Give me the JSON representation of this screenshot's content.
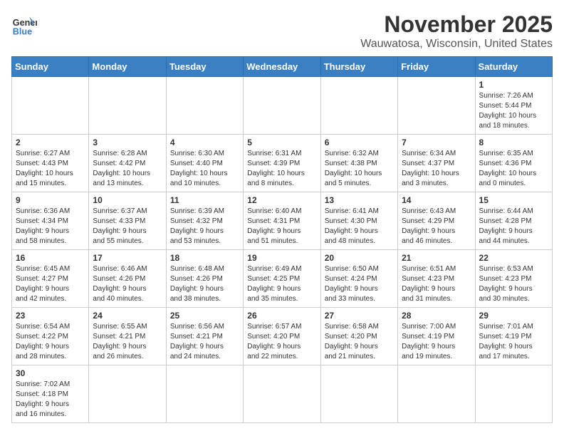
{
  "header": {
    "logo_general": "General",
    "logo_blue": "Blue",
    "month": "November 2025",
    "location": "Wauwatosa, Wisconsin, United States"
  },
  "weekdays": [
    "Sunday",
    "Monday",
    "Tuesday",
    "Wednesday",
    "Thursday",
    "Friday",
    "Saturday"
  ],
  "weeks": [
    [
      {
        "day": "",
        "info": ""
      },
      {
        "day": "",
        "info": ""
      },
      {
        "day": "",
        "info": ""
      },
      {
        "day": "",
        "info": ""
      },
      {
        "day": "",
        "info": ""
      },
      {
        "day": "",
        "info": ""
      },
      {
        "day": "1",
        "info": "Sunrise: 7:26 AM\nSunset: 5:44 PM\nDaylight: 10 hours\nand 18 minutes."
      }
    ],
    [
      {
        "day": "2",
        "info": "Sunrise: 6:27 AM\nSunset: 4:43 PM\nDaylight: 10 hours\nand 15 minutes."
      },
      {
        "day": "3",
        "info": "Sunrise: 6:28 AM\nSunset: 4:42 PM\nDaylight: 10 hours\nand 13 minutes."
      },
      {
        "day": "4",
        "info": "Sunrise: 6:30 AM\nSunset: 4:40 PM\nDaylight: 10 hours\nand 10 minutes."
      },
      {
        "day": "5",
        "info": "Sunrise: 6:31 AM\nSunset: 4:39 PM\nDaylight: 10 hours\nand 8 minutes."
      },
      {
        "day": "6",
        "info": "Sunrise: 6:32 AM\nSunset: 4:38 PM\nDaylight: 10 hours\nand 5 minutes."
      },
      {
        "day": "7",
        "info": "Sunrise: 6:34 AM\nSunset: 4:37 PM\nDaylight: 10 hours\nand 3 minutes."
      },
      {
        "day": "8",
        "info": "Sunrise: 6:35 AM\nSunset: 4:36 PM\nDaylight: 10 hours\nand 0 minutes."
      }
    ],
    [
      {
        "day": "9",
        "info": "Sunrise: 6:36 AM\nSunset: 4:34 PM\nDaylight: 9 hours\nand 58 minutes."
      },
      {
        "day": "10",
        "info": "Sunrise: 6:37 AM\nSunset: 4:33 PM\nDaylight: 9 hours\nand 55 minutes."
      },
      {
        "day": "11",
        "info": "Sunrise: 6:39 AM\nSunset: 4:32 PM\nDaylight: 9 hours\nand 53 minutes."
      },
      {
        "day": "12",
        "info": "Sunrise: 6:40 AM\nSunset: 4:31 PM\nDaylight: 9 hours\nand 51 minutes."
      },
      {
        "day": "13",
        "info": "Sunrise: 6:41 AM\nSunset: 4:30 PM\nDaylight: 9 hours\nand 48 minutes."
      },
      {
        "day": "14",
        "info": "Sunrise: 6:43 AM\nSunset: 4:29 PM\nDaylight: 9 hours\nand 46 minutes."
      },
      {
        "day": "15",
        "info": "Sunrise: 6:44 AM\nSunset: 4:28 PM\nDaylight: 9 hours\nand 44 minutes."
      }
    ],
    [
      {
        "day": "16",
        "info": "Sunrise: 6:45 AM\nSunset: 4:27 PM\nDaylight: 9 hours\nand 42 minutes."
      },
      {
        "day": "17",
        "info": "Sunrise: 6:46 AM\nSunset: 4:26 PM\nDaylight: 9 hours\nand 40 minutes."
      },
      {
        "day": "18",
        "info": "Sunrise: 6:48 AM\nSunset: 4:26 PM\nDaylight: 9 hours\nand 38 minutes."
      },
      {
        "day": "19",
        "info": "Sunrise: 6:49 AM\nSunset: 4:25 PM\nDaylight: 9 hours\nand 35 minutes."
      },
      {
        "day": "20",
        "info": "Sunrise: 6:50 AM\nSunset: 4:24 PM\nDaylight: 9 hours\nand 33 minutes."
      },
      {
        "day": "21",
        "info": "Sunrise: 6:51 AM\nSunset: 4:23 PM\nDaylight: 9 hours\nand 31 minutes."
      },
      {
        "day": "22",
        "info": "Sunrise: 6:53 AM\nSunset: 4:23 PM\nDaylight: 9 hours\nand 30 minutes."
      }
    ],
    [
      {
        "day": "23",
        "info": "Sunrise: 6:54 AM\nSunset: 4:22 PM\nDaylight: 9 hours\nand 28 minutes."
      },
      {
        "day": "24",
        "info": "Sunrise: 6:55 AM\nSunset: 4:21 PM\nDaylight: 9 hours\nand 26 minutes."
      },
      {
        "day": "25",
        "info": "Sunrise: 6:56 AM\nSunset: 4:21 PM\nDaylight: 9 hours\nand 24 minutes."
      },
      {
        "day": "26",
        "info": "Sunrise: 6:57 AM\nSunset: 4:20 PM\nDaylight: 9 hours\nand 22 minutes."
      },
      {
        "day": "27",
        "info": "Sunrise: 6:58 AM\nSunset: 4:20 PM\nDaylight: 9 hours\nand 21 minutes."
      },
      {
        "day": "28",
        "info": "Sunrise: 7:00 AM\nSunset: 4:19 PM\nDaylight: 9 hours\nand 19 minutes."
      },
      {
        "day": "29",
        "info": "Sunrise: 7:01 AM\nSunset: 4:19 PM\nDaylight: 9 hours\nand 17 minutes."
      }
    ],
    [
      {
        "day": "30",
        "info": "Sunrise: 7:02 AM\nSunset: 4:18 PM\nDaylight: 9 hours\nand 16 minutes."
      },
      {
        "day": "",
        "info": ""
      },
      {
        "day": "",
        "info": ""
      },
      {
        "day": "",
        "info": ""
      },
      {
        "day": "",
        "info": ""
      },
      {
        "day": "",
        "info": ""
      },
      {
        "day": "",
        "info": ""
      }
    ]
  ]
}
